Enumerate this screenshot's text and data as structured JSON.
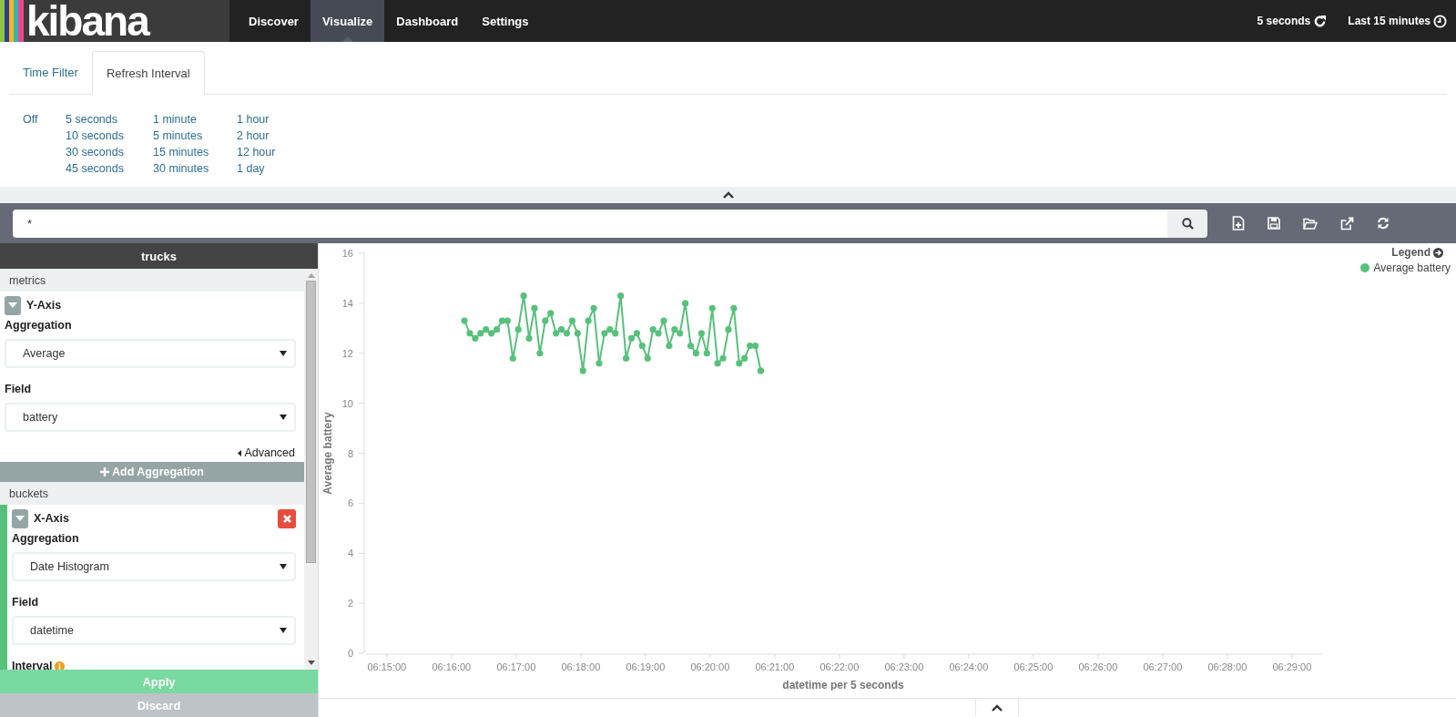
{
  "navbar": {
    "logo": "kibana",
    "items": [
      {
        "label": "Discover",
        "selected": false
      },
      {
        "label": "Visualize",
        "selected": true
      },
      {
        "label": "Dashboard",
        "selected": false
      },
      {
        "label": "Settings",
        "selected": false
      }
    ],
    "refresh": "5 seconds",
    "timerange": "Last 15 minutes"
  },
  "time_panel": {
    "tabs": [
      {
        "label": "Time Filter",
        "selected": false
      },
      {
        "label": "Refresh Interval",
        "selected": true
      }
    ],
    "option_columns": [
      [
        "Off"
      ],
      [
        "5 seconds",
        "10 seconds",
        "30 seconds",
        "45 seconds"
      ],
      [
        "1 minute",
        "5 minutes",
        "15 minutes",
        "30 minutes"
      ],
      [
        "1 hour",
        "2 hour",
        "12 hour",
        "1 day"
      ]
    ]
  },
  "search": {
    "value": "*"
  },
  "sidebar": {
    "title": "trucks",
    "sections": [
      {
        "title": "metrics",
        "aggs": [
          {
            "kind": "metric",
            "title": "Y-Axis",
            "removable": false,
            "fields": [
              {
                "kind": "select",
                "label": "Aggregation",
                "value": "Average"
              },
              {
                "kind": "select",
                "label": "Field",
                "value": "battery"
              }
            ]
          }
        ],
        "advanced": "Advanced",
        "add_button": "Add Aggregation"
      },
      {
        "title": "buckets",
        "aggs": [
          {
            "kind": "bucket",
            "title": "X-Axis",
            "removable": true,
            "fields": [
              {
                "kind": "select",
                "label": "Aggregation",
                "value": "Date Histogram"
              },
              {
                "kind": "select",
                "label": "Field",
                "value": "datetime"
              },
              {
                "kind": "info",
                "label": "Interval"
              }
            ]
          }
        ]
      }
    ],
    "apply": "Apply",
    "discard": "Discard"
  },
  "legend": {
    "title": "Legend"
  },
  "chart_data": {
    "type": "line",
    "xlabel": "datetime per 5 seconds",
    "ylabel": "Average battery",
    "x": [
      22572,
      22577,
      22582,
      22587,
      22592,
      22597,
      22602,
      22607,
      22612,
      22617,
      22622,
      22627,
      22632,
      22637,
      22642,
      22647,
      22652,
      22657,
      22662,
      22667,
      22672,
      22677,
      22682,
      22687,
      22692,
      22697,
      22702,
      22707,
      22712,
      22717,
      22722,
      22727,
      22732,
      22737,
      22742,
      22747,
      22752,
      22757,
      22762,
      22767,
      22772,
      22777,
      22782,
      22787,
      22792,
      22797,
      22802,
      22807,
      22812,
      22817,
      22822,
      22827,
      22832,
      22837,
      22842,
      22847
    ],
    "series": [
      {
        "name": "Average battery",
        "color": "#57c17b",
        "marker": "circle",
        "values": [
          13.3,
          12.8,
          12.6,
          12.8,
          12.95,
          12.8,
          12.95,
          13.3,
          13.3,
          11.8,
          12.95,
          14.3,
          12.6,
          13.8,
          12.0,
          13.3,
          13.6,
          12.8,
          12.95,
          12.8,
          13.3,
          12.8,
          11.3,
          13.3,
          13.8,
          11.6,
          12.8,
          12.95,
          12.8,
          14.3,
          11.8,
          12.6,
          12.8,
          12.3,
          11.8,
          12.95,
          12.8,
          13.3,
          12.3,
          12.95,
          12.8,
          14.0,
          12.3,
          12.0,
          12.8,
          12.0,
          13.8,
          11.6,
          11.8,
          12.95,
          13.8,
          11.6,
          11.8,
          12.3,
          12.3,
          11.3
        ]
      }
    ],
    "xlim": [
      22479,
      23368
    ],
    "ylim": [
      0,
      16
    ],
    "xticks": [
      {
        "value": 22500,
        "label": "06:15:00"
      },
      {
        "value": 22560,
        "label": "06:16:00"
      },
      {
        "value": 22620,
        "label": "06:17:00"
      },
      {
        "value": 22680,
        "label": "06:18:00"
      },
      {
        "value": 22740,
        "label": "06:19:00"
      },
      {
        "value": 22800,
        "label": "06:20:00"
      },
      {
        "value": 22860,
        "label": "06:21:00"
      },
      {
        "value": 22920,
        "label": "06:22:00"
      },
      {
        "value": 22980,
        "label": "06:23:00"
      },
      {
        "value": 23040,
        "label": "06:24:00"
      },
      {
        "value": 23100,
        "label": "06:25:00"
      },
      {
        "value": 23160,
        "label": "06:26:00"
      },
      {
        "value": 23220,
        "label": "06:27:00"
      },
      {
        "value": 23280,
        "label": "06:28:00"
      },
      {
        "value": 23340,
        "label": "06:29:00"
      }
    ],
    "yticks": [
      0,
      2,
      4,
      6,
      8,
      10,
      12,
      14,
      16
    ]
  }
}
